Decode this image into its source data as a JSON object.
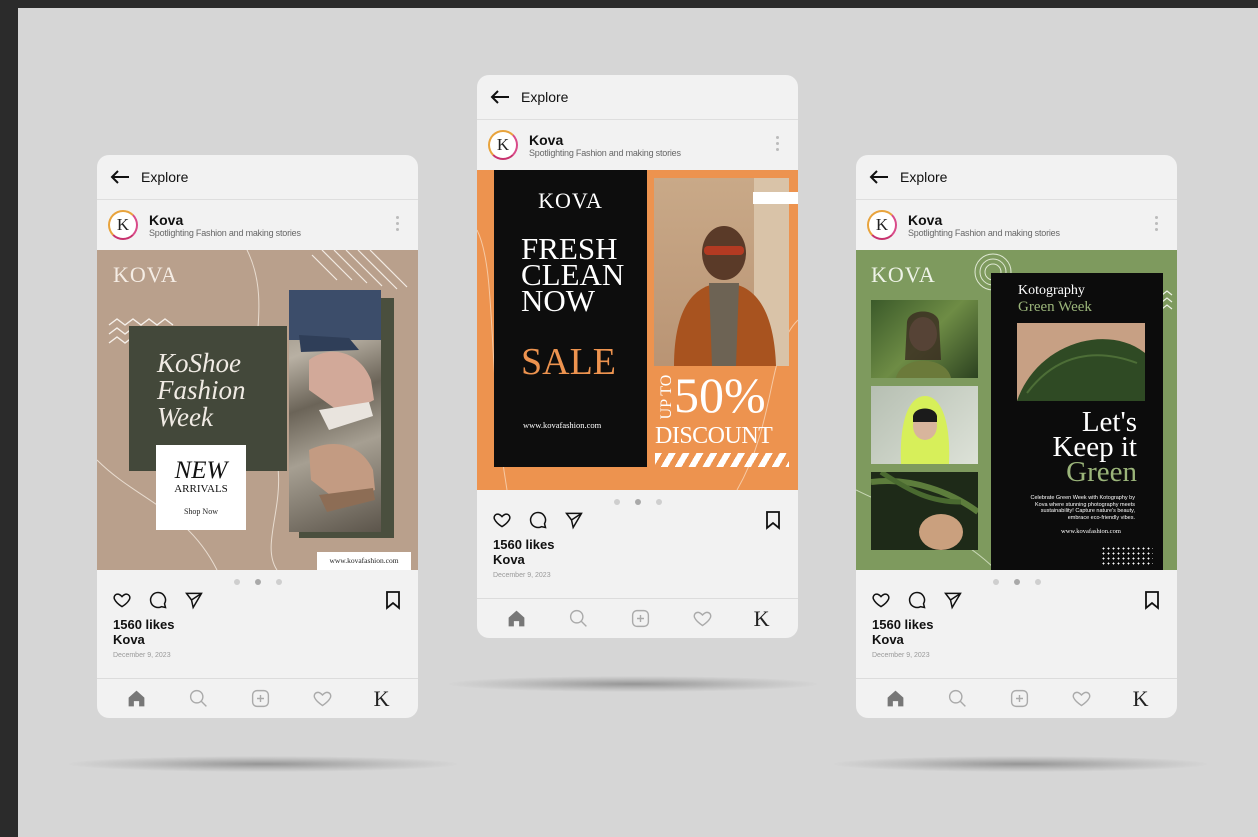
{
  "common": {
    "explore": "Explore",
    "profile_name": "Kova",
    "profile_sub": "Spotlighting Fashion and making stories",
    "avatar_letter": "K",
    "likes": "1560 likes",
    "username": "Kova",
    "date": "December 9, 2023",
    "nav_icons": [
      "home-icon",
      "search-icon",
      "add-post-icon",
      "heart-icon",
      "profile-k-icon"
    ]
  },
  "post1": {
    "brand": "KOVA",
    "headline": [
      "KoShoe",
      "Fashion",
      "Week"
    ],
    "new_label": "NEW",
    "arrivals": "ARRIVALS",
    "shop": "Shop Now",
    "url": "www.kovafashion.com",
    "colors": {
      "bg": "#b9a08c",
      "panel": "#43483a"
    }
  },
  "post2": {
    "brand": "KOVA",
    "headline": [
      "FRESH",
      "CLEAN",
      "NOW"
    ],
    "sale": "SALE",
    "url": "www.kovafashion.com",
    "up_to": "UP TO",
    "percent": "50%",
    "discount": "DISCOUNT",
    "colors": {
      "bg": "#ed934f",
      "panel": "#0d0d0d"
    }
  },
  "post3": {
    "brand": "KOVA",
    "title1": "Kotography",
    "title2": "Green Week",
    "big": [
      "Let's",
      "Keep it",
      "Green"
    ],
    "body": "Celebrate Green Week with Kotography by Kova where stunning photography meets sustainability! Capture nature's beauty, embrace eco-friendly vibes.",
    "url": "www.kovafashion.com",
    "colors": {
      "bg": "#7e9a5e",
      "panel": "#0c0c0c",
      "accent": "#9bb57a"
    }
  }
}
